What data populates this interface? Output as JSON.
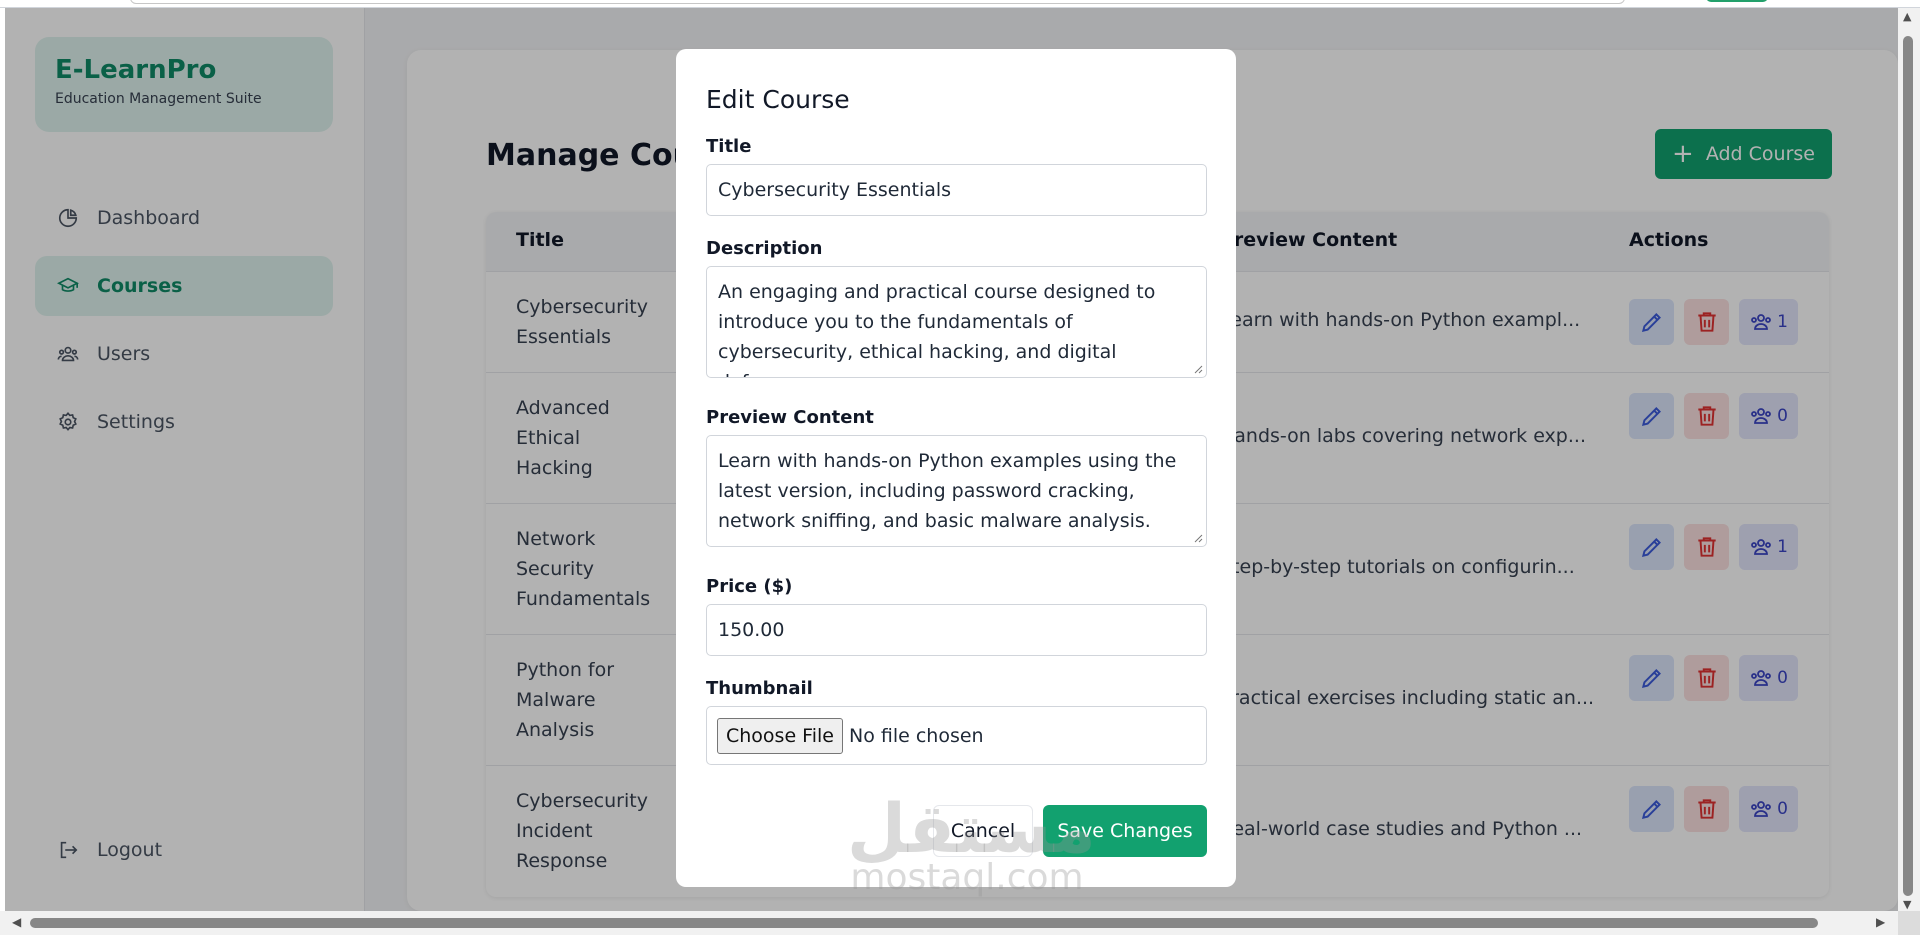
{
  "sidebar": {
    "brand_title": "E-LearnPro",
    "brand_subtitle": "Education Management Suite",
    "items": [
      {
        "label": "Dashboard",
        "icon": "chart-pie-icon",
        "active": false
      },
      {
        "label": "Courses",
        "icon": "graduation-cap-icon",
        "active": true
      },
      {
        "label": "Users",
        "icon": "users-icon",
        "active": false
      },
      {
        "label": "Settings",
        "icon": "gear-icon",
        "active": false
      }
    ],
    "logout_label": "Logout"
  },
  "main": {
    "page_title": "Manage Cour",
    "add_button_label": "Add Course",
    "table": {
      "headers": {
        "title": "Title",
        "preview": "Preview Content",
        "actions": "Actions"
      },
      "rows": [
        {
          "title": "Cybersecurity Essentials",
          "preview": "Learn with hands-on Python exampl...",
          "students": "1"
        },
        {
          "title": "Advanced Ethical Hacking",
          "preview": "Hands-on labs covering network exp...",
          "students": "0"
        },
        {
          "title": "Network Security Fundamentals",
          "preview": "Step-by-step tutorials on configurin...",
          "students": "1"
        },
        {
          "title": "Python for Malware Analysis",
          "preview": "Practical exercises including static an...",
          "students": "0"
        },
        {
          "title": "Cybersecurity Incident Response",
          "preview": "Real-world case studies and Python ...",
          "students": "0"
        }
      ]
    }
  },
  "modal": {
    "title": "Edit Course",
    "title_label": "Title",
    "title_value": "Cybersecurity Essentials",
    "description_label": "Description",
    "description_value": "An engaging and practical course designed to introduce you to the fundamentals of cybersecurity, ethical hacking, and digital defense.",
    "preview_label": "Preview Content",
    "preview_value": "Learn with hands-on Python examples using the latest version, including password cracking, network sniffing, and basic malware analysis.",
    "price_label": "Price ($)",
    "price_value": "150.00",
    "thumbnail_label": "Thumbnail",
    "file_button_label": "Choose File",
    "file_status": "No file chosen",
    "cancel_label": "Cancel",
    "save_label": "Save Changes"
  },
  "watermark": {
    "arabic": "مستقل",
    "latin": "mostaql.com"
  },
  "colors": {
    "accent": "#12a16f",
    "brand_bg": "#dff3ee",
    "brand_text": "#0f8a66",
    "edit_bg": "#dbe5fb",
    "delete_bg": "#fbe0e0",
    "users_bg": "#e2e5fb"
  }
}
